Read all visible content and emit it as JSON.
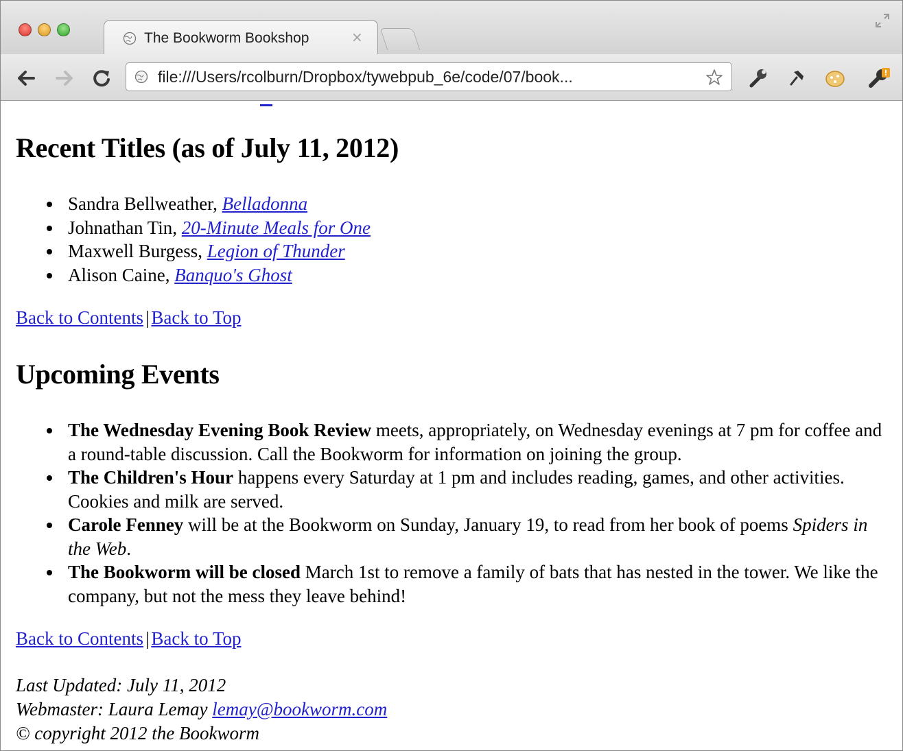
{
  "browser": {
    "tab_title": "The Bookworm Bookshop",
    "tab_close": "×",
    "url": "file:///Users/rcolburn/Dropbox/tywebpub_6e/code/07/book...",
    "traffic_light_colors": [
      "#e0443e",
      "#dea123",
      "#1aab29"
    ]
  },
  "recent": {
    "heading": "Recent Titles (as of July 11, 2012)",
    "items": [
      {
        "author": "Sandra Bellweather, ",
        "title": "Belladonna"
      },
      {
        "author": "Johnathan Tin, ",
        "title": "20-Minute Meals for One"
      },
      {
        "author": "Maxwell Burgess, ",
        "title": "Legion of Thunder"
      },
      {
        "author": "Alison Caine, ",
        "title": "Banquo's Ghost"
      }
    ]
  },
  "nav": {
    "back_contents": "Back to Contents",
    "separator": "|",
    "back_top": "Back to Top"
  },
  "events": {
    "heading": "Upcoming Events",
    "items": [
      {
        "bold": "The Wednesday Evening Book Review",
        "text": " meets, appropriately, on Wednesday evenings at 7 pm for coffee and a round-table discussion. Call the Bookworm for information on joining the group."
      },
      {
        "bold": "The Children's Hour",
        "text": " happens every Saturday at 1 pm and includes reading, games, and other activities. Cookies and milk are served."
      },
      {
        "bold": "Carole Fenney",
        "text": " will be at the Bookworm on Sunday, January 19, to read from her book of poems ",
        "italic": "Spiders in the Web",
        "tail": "."
      },
      {
        "bold": "The Bookworm will be closed",
        "text": " March 1st to remove a family of bats that has nested in the tower. We like the company, but not the mess they leave behind!"
      }
    ]
  },
  "footer": {
    "updated": "Last Updated: July 11, 2012",
    "webmaster_label": "Webmaster: Laura Lemay ",
    "email": "lemay@bookworm.com",
    "copyright": "© copyright 2012 the Bookworm"
  },
  "link_color": "#2222cc"
}
